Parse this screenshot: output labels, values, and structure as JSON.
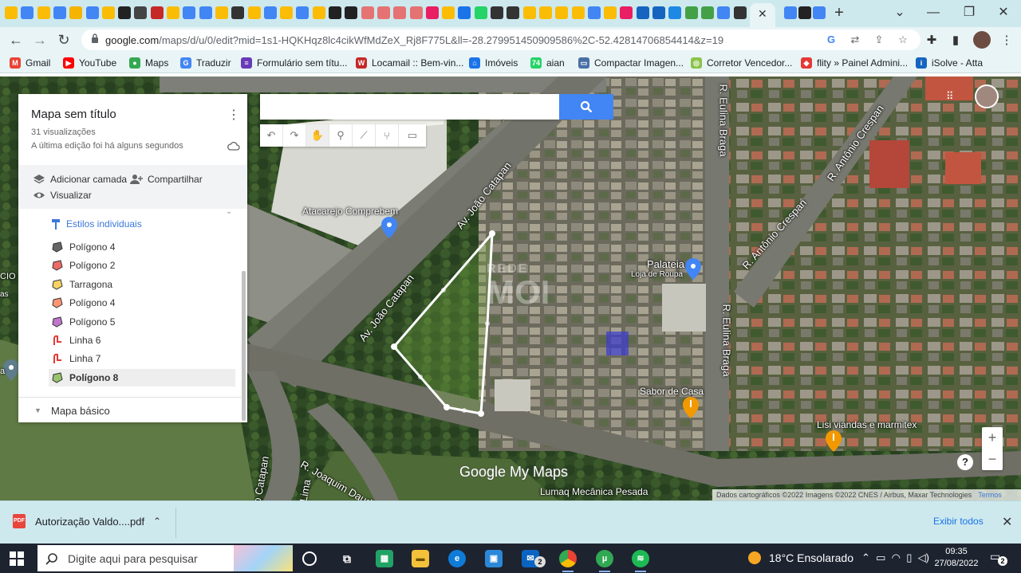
{
  "browser": {
    "url_host": "google.com",
    "url_path": "/maps/d/u/0/edit?mid=1s1-HQKHqz8lc4cikWfMdZeX_Rj8F775L&ll=-28.279951450909586%2C-52.42814706854414&z=19",
    "new_tab": "+"
  },
  "bookmarks": [
    {
      "label": "Gmail",
      "icon": "gmail-icon",
      "color": "#ea4335",
      "glyph": "M"
    },
    {
      "label": "YouTube",
      "icon": "youtube-icon",
      "color": "#ff0000",
      "glyph": "▶"
    },
    {
      "label": "Maps",
      "icon": "maps-icon",
      "color": "#34a853",
      "glyph": "●"
    },
    {
      "label": "Traduzir",
      "icon": "translate-icon",
      "color": "#4285f4",
      "glyph": "G"
    },
    {
      "label": "Formulário sem títu...",
      "icon": "forms-icon",
      "color": "#673ab7",
      "glyph": "≡"
    },
    {
      "label": "Locamail :: Bem-vin...",
      "icon": "locamail-icon",
      "color": "#c62828",
      "glyph": "W"
    },
    {
      "label": "Imóveis",
      "icon": "home-icon",
      "color": "#1a73e8",
      "glyph": "⌂"
    },
    {
      "label": "aian",
      "icon": "whatsapp-icon",
      "color": "#25d366",
      "glyph": "74"
    },
    {
      "label": "Compactar Imagen...",
      "icon": "compress-icon",
      "color": "#4a6fa5",
      "glyph": "▭"
    },
    {
      "label": "Corretor Vencedor...",
      "icon": "corretor-icon",
      "color": "#8bc34a",
      "glyph": "◎"
    },
    {
      "label": "flity » Painel Admini...",
      "icon": "flity-icon",
      "color": "#e53935",
      "glyph": "◆"
    },
    {
      "label": "iSolve - Atta",
      "icon": "isolve-icon",
      "color": "#1565c0",
      "glyph": "i"
    }
  ],
  "panel": {
    "title": "Mapa sem título",
    "views": "31 visualizações",
    "edited": "A última edição foi há alguns segundos",
    "add_layer": "Adicionar camada",
    "share": "Compartilhar",
    "preview": "Visualizar",
    "styles_link": "Estilos individuais",
    "items": [
      {
        "label": "Polígono 4",
        "icon": "polygon-icon",
        "color": "#333333",
        "selected": false
      },
      {
        "label": "Polígono 2",
        "icon": "polygon-icon",
        "color": "#e53935",
        "selected": false
      },
      {
        "label": "Tarragona",
        "icon": "polygon-icon",
        "color": "#f4c430",
        "selected": false
      },
      {
        "label": "Polígono 4",
        "icon": "polygon-icon",
        "color": "#ff7043",
        "selected": false
      },
      {
        "label": "Polígono 5",
        "icon": "polygon-icon",
        "color": "#ab47bc",
        "selected": false
      },
      {
        "label": "Linha 6",
        "icon": "line-icon",
        "color": "#e53935",
        "selected": false
      },
      {
        "label": "Linha 7",
        "icon": "line-icon",
        "color": "#e53935",
        "selected": false
      },
      {
        "label": "Polígono 8",
        "icon": "polygon-icon",
        "color": "#7cb342",
        "selected": true
      }
    ],
    "base_map": "Mapa básico"
  },
  "map": {
    "search_placeholder": "",
    "labels": {
      "atacarejo": "Atacarejo Comprebem",
      "palateia": "Palateia",
      "palateia_sub": "Loja de Roupa",
      "sabor": "Sabor de Casa",
      "lisi": "Lisi viandas e marmitex",
      "lumaq": "Lumaq Mecânica Pesada",
      "cio": "CIO",
      "as": "as",
      "a": "a"
    },
    "streets": {
      "joao1": "Av. João Catapan",
      "joao2": "Av. João Catapan",
      "joao3": "o Catapan",
      "eulina1": "R. Eulina Braga",
      "eulina2": "R. Eulina Braga",
      "crespan1": "R. Antônio Crespan",
      "crespan2": "R. Antônio Crespan",
      "joaquim": "R. Joaquim Daudt",
      "lima": "Lima"
    },
    "google_logo": "Google My Maps",
    "watermark_top": "REDE",
    "watermark_main": "MOI",
    "attribution": "Dados cartográficos ©2022 Imagens ©2022 CNES / Airbus, Maxar Technologies",
    "terms": "Termos",
    "zoom_in": "+",
    "zoom_out": "−",
    "help": "?",
    "polygon_color": "#7cb342"
  },
  "download": {
    "file": "Autorização Valdo....pdf",
    "show_all": "Exibir todos",
    "close": "✕"
  },
  "taskbar": {
    "search_placeholder": "Digite aqui para pesquisar",
    "weather": "18°C  Ensolarado",
    "time": "09:35",
    "date": "27/08/2022",
    "notifications": "2",
    "mail_badge": "2"
  }
}
